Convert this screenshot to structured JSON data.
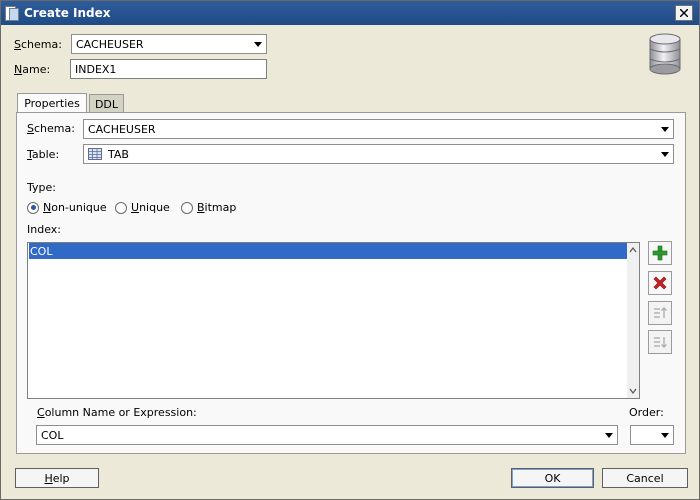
{
  "window": {
    "title": "Create Index",
    "close_icon": "close-icon"
  },
  "header": {
    "schema_label_prefix": "S",
    "schema_label_rest": "chema:",
    "schema_value": "CACHEUSER",
    "name_label_prefix": "N",
    "name_label_rest": "ame:",
    "name_value": "INDEX1",
    "database_icon": "database-icon"
  },
  "tabs": [
    {
      "label": "Properties",
      "active": true
    },
    {
      "label": "DDL",
      "active": false
    }
  ],
  "properties": {
    "schema_label_prefix": "S",
    "schema_label_rest": "chema:",
    "schema_value": "CACHEUSER",
    "table_label_prefix": "T",
    "table_label_rest": "able:",
    "table_value": "TAB",
    "table_icon": "table-icon",
    "type_label": "Type:",
    "type_options": [
      {
        "prefix": "N",
        "rest": "on-unique",
        "selected": true
      },
      {
        "prefix": "U",
        "rest": "nique",
        "selected": false
      },
      {
        "prefix": "B",
        "rest": "itmap",
        "selected": false
      }
    ],
    "index_label": "Index:",
    "index_rows": [
      "COL"
    ],
    "column_label_prefix": "C",
    "column_label_rest": "olumn Name or Expression:",
    "column_value": "COL",
    "order_label": "Order:",
    "order_value": ""
  },
  "side_buttons": [
    {
      "name": "add-icon",
      "enabled": true
    },
    {
      "name": "delete-icon",
      "enabled": true
    },
    {
      "name": "move-up-icon",
      "enabled": false
    },
    {
      "name": "move-down-icon",
      "enabled": false
    }
  ],
  "footer": {
    "help_prefix": "H",
    "help_rest": "elp",
    "ok_label": "OK",
    "cancel_label": "Cancel"
  },
  "colors": {
    "selection": "#3169c6",
    "titlebar": "#2f5d9a",
    "add": "#2f9a2f",
    "delete": "#cc2020"
  }
}
